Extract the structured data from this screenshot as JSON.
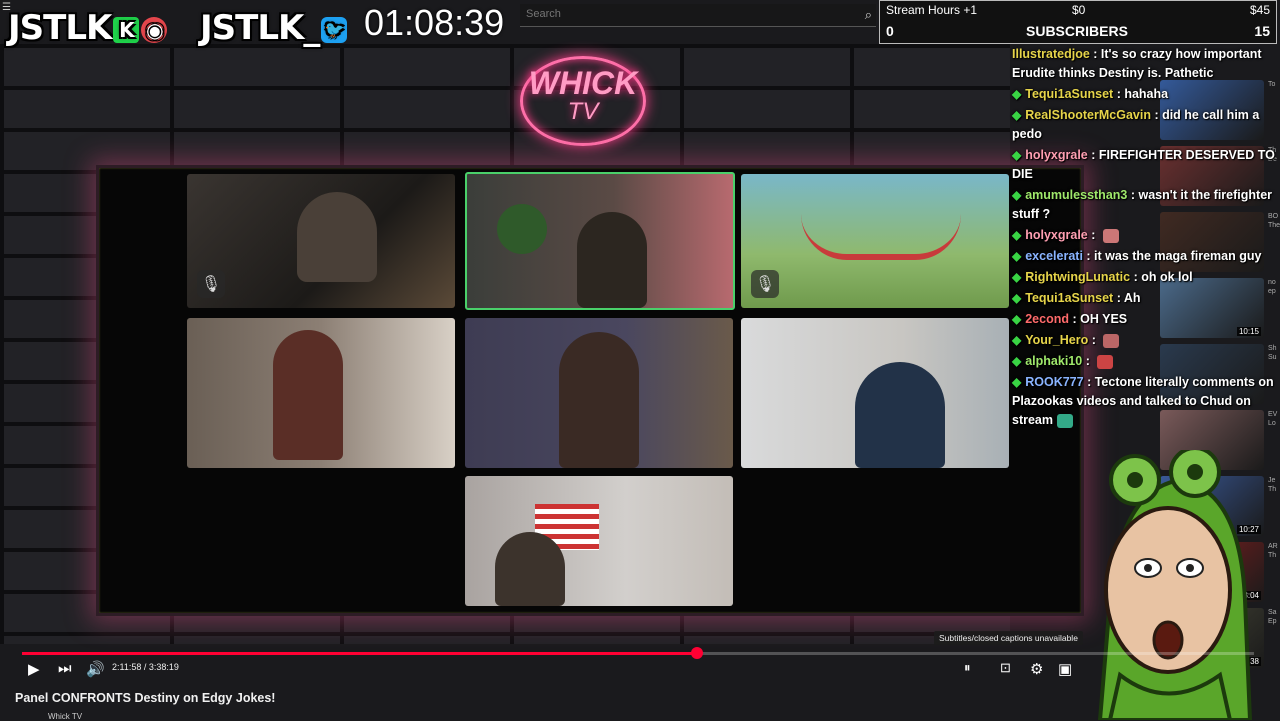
{
  "overlay": {
    "brand1": "JSTLK",
    "brand1_badge": "K",
    "brand2": "JSTLK_",
    "timer": "01:08:39"
  },
  "search": {
    "placeholder": "Search"
  },
  "stats": {
    "label": "Stream Hours +1",
    "amount_current": "$0",
    "amount_goal": "$45",
    "subs_title": "SUBSCRIBERS",
    "subs_current": "0",
    "subs_goal": "15"
  },
  "logo": {
    "line1": "WHICK",
    "line2": "TV"
  },
  "chat": [
    {
      "badge": false,
      "user": "Illustratedjoe",
      "color": "#e6d44a",
      "text": "It's so crazy how important Erudite thinks Destiny is. Pathetic"
    },
    {
      "badge": true,
      "user": "Tequi1aSunset",
      "color": "#e6d44a",
      "text": "hahaha"
    },
    {
      "badge": true,
      "user": "RealShooterMcGavin",
      "color": "#e6d44a",
      "text": "did he call him a pedo"
    },
    {
      "badge": true,
      "user": "holyxgrale",
      "color": "#ff9fb2",
      "text": "FIREFIGHTER DESERVED TO DIE"
    },
    {
      "badge": true,
      "user": "amumulessthan3",
      "color": "#9fe86b",
      "text": "wasn't it the firefighter stuff ?"
    },
    {
      "badge": true,
      "user": "holyxgrale",
      "color": "#ff9fb2",
      "text": "",
      "emote": "#c77"
    },
    {
      "badge": true,
      "user": "excelerati",
      "color": "#8ab4ff",
      "text": "it was the maga fireman guy"
    },
    {
      "badge": true,
      "user": "RightwingLunatic",
      "color": "#e6d44a",
      "text": "oh ok lol"
    },
    {
      "badge": true,
      "user": "Tequi1aSunset",
      "color": "#e6d44a",
      "text": "Ah"
    },
    {
      "badge": true,
      "user": "2econd",
      "color": "#ff6b6b",
      "text": "OH YES"
    },
    {
      "badge": true,
      "user": "Your_Hero",
      "color": "#e6d44a",
      "text": "",
      "emote": "#b66"
    },
    {
      "badge": true,
      "user": "alphaki10",
      "color": "#9fe86b",
      "text": "",
      "emote": "#c44"
    },
    {
      "badge": true,
      "user": "ROOK777",
      "color": "#8ab4ff",
      "text": "Tectone literally comments on Plazookas videos and talked to Chud on stream",
      "emote": "#3a8"
    }
  ],
  "thumbs": [
    {
      "dur": "",
      "side": "To"
    },
    {
      "dur": "",
      "side": "Th De"
    },
    {
      "dur": "",
      "side": "BO The"
    },
    {
      "dur": "10:15",
      "side": "no ep"
    },
    {
      "dur": "",
      "side": "Sh Su"
    },
    {
      "dur": "",
      "side": "EV Lo"
    },
    {
      "dur": "10:27",
      "side": "Je Th"
    },
    {
      "dur": "13:04",
      "side": "AR Th"
    },
    {
      "dur": "51:38",
      "side": "Sa Ep"
    }
  ],
  "player": {
    "progress": 0.548,
    "time": "2:11:58 / 3:38:19",
    "tooltip": "Subtitles/closed captions unavailable",
    "title": "Panel CONFRONTS Destiny on Edgy Jokes!",
    "channel": "Whick TV"
  },
  "colors": {
    "accent": "#ff0033",
    "neon": "#ff3d8a",
    "chat_badge": "#39d444"
  }
}
